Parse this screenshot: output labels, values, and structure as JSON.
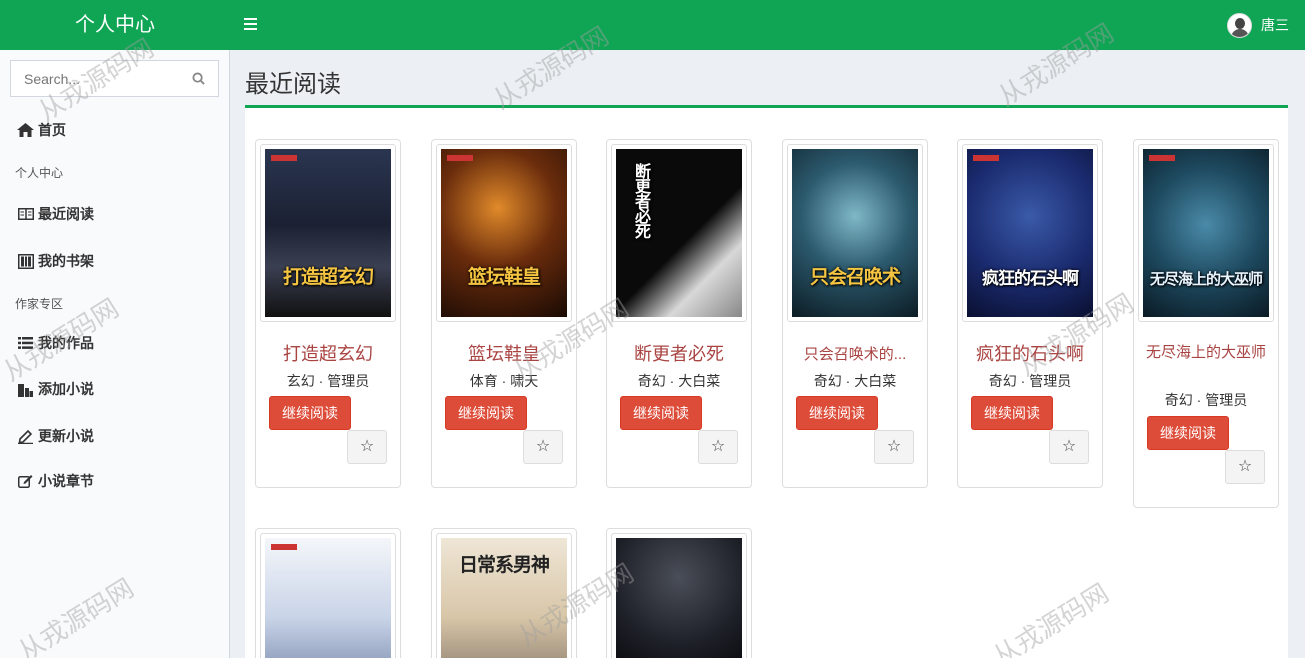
{
  "header": {
    "brand": "个人中心",
    "user_name": "唐三"
  },
  "sidebar": {
    "search_placeholder": "Search...",
    "home": "首页",
    "section_personal": "个人中心",
    "recent": "最近阅读",
    "bookshelf": "我的书架",
    "section_author": "作家专区",
    "works": "我的作品",
    "add_novel": "添加小说",
    "update_novel": "更新小说",
    "chapters": "小说章节"
  },
  "main": {
    "title": "最近阅读",
    "read_button": "继续阅读",
    "star_glyph": "☆",
    "books": [
      {
        "title": "打造超玄幻",
        "meta": "玄幻 · 管理员",
        "cover_text": "打造超玄幻"
      },
      {
        "title": "篮坛鞋皇",
        "meta": "体育 · 啸天",
        "cover_text": "篮坛鞋皇"
      },
      {
        "title": "断更者必死",
        "meta": "奇幻 · 大白菜",
        "cover_text": "断更者必死"
      },
      {
        "title": "只会召唤术的...",
        "meta": "奇幻 · 大白菜",
        "cover_text": "只会召唤术"
      },
      {
        "title": "疯狂的石头啊",
        "meta": "奇幻 · 管理员",
        "cover_text": "疯狂的石头啊"
      },
      {
        "title": "无尽海上的大巫师",
        "meta": "奇幻 · 管理员",
        "cover_text": "无尽海上的大巫师"
      },
      {
        "title": "",
        "meta": "",
        "cover_text": ""
      },
      {
        "title": "",
        "meta": "",
        "cover_text": "日常系男神"
      },
      {
        "title": "",
        "meta": "",
        "cover_text": ""
      }
    ]
  },
  "watermark": "从戎源码网",
  "colors": {
    "header": "#0fa554",
    "button": "#dd4b39",
    "title": "#a94442"
  }
}
